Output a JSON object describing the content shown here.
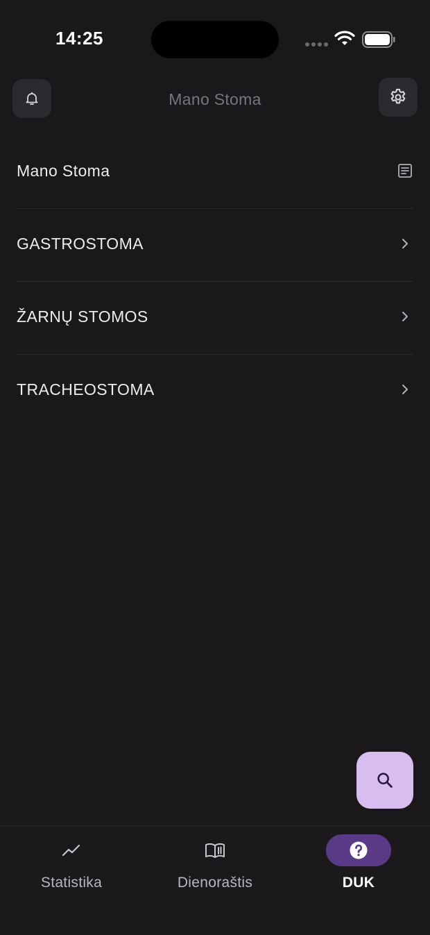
{
  "status_bar": {
    "time": "14:25"
  },
  "header": {
    "title": "Mano Stoma",
    "left_icon": "bell-icon",
    "right_icon": "gear-icon"
  },
  "menu": {
    "items": [
      {
        "label": "Mano Stoma",
        "icon": "document-icon"
      },
      {
        "label": "GASTROSTOMA",
        "icon": "chevron-right-icon"
      },
      {
        "label": "ŽARNŲ STOMOS",
        "icon": "chevron-right-icon"
      },
      {
        "label": "TRACHEOSTOMA",
        "icon": "chevron-right-icon"
      }
    ]
  },
  "fab": {
    "icon": "search-icon",
    "color": "#d8bdf0"
  },
  "bottom_nav": {
    "items": [
      {
        "label": "Statistika",
        "icon": "trending-icon",
        "active": false
      },
      {
        "label": "Dienoraštis",
        "icon": "book-icon",
        "active": false
      },
      {
        "label": "DUK",
        "icon": "help-icon",
        "active": true
      }
    ],
    "active_color": "#5a3a86"
  },
  "colors": {
    "background": "#1a181b",
    "surface": "#2c2a2f",
    "accent": "#d8bdf0"
  }
}
